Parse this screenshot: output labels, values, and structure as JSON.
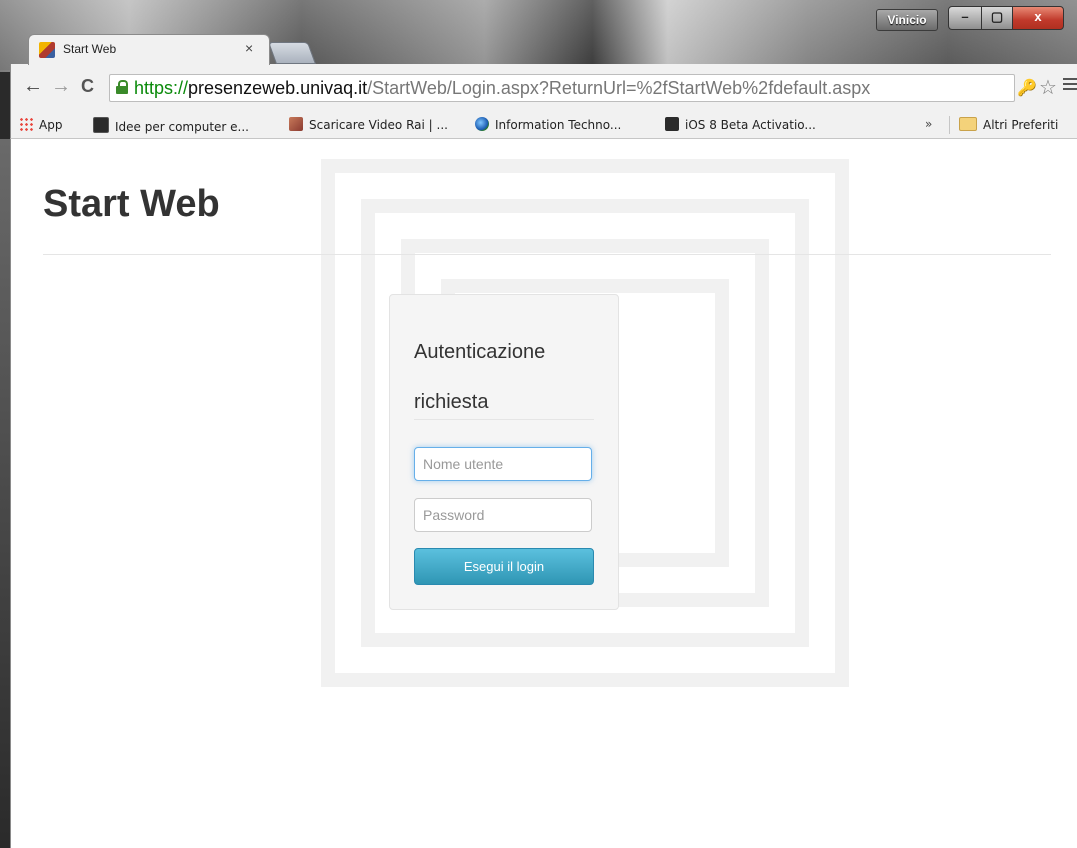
{
  "window": {
    "user_badge": "Vinicio",
    "controls": {
      "minimize": "–",
      "maximize": "▢",
      "close": "x"
    }
  },
  "tabs": [
    {
      "title": "Start Web",
      "close_glyph": "×",
      "favicon": "start-web-favicon"
    }
  ],
  "toolbar": {
    "back_glyph": "←",
    "forward_glyph": "→",
    "reload_glyph": "C",
    "url": {
      "scheme": "https://",
      "host": "presenzeweb.univaq.it",
      "path": "/StartWeb/Login.aspx?ReturnUrl=%2fStartWeb%2fdefault.aspx"
    },
    "key_glyph": "🔑",
    "star_glyph": "☆"
  },
  "bookmarks": {
    "items": [
      {
        "label": "App",
        "icon": "apps-icon"
      },
      {
        "label": "Idee per computer e...",
        "icon": "ideas-icon"
      },
      {
        "label": "Scaricare Video Rai | ...",
        "icon": "rai-icon"
      },
      {
        "label": "Information Techno...",
        "icon": "globe-icon"
      },
      {
        "label": "iOS 8 Beta Activatio...",
        "icon": "ios-icon"
      }
    ],
    "overflow_glyph": "»",
    "other": {
      "label": "Altri Preferiti",
      "icon": "folder-icon"
    }
  },
  "page": {
    "site_title": "Start Web",
    "login": {
      "heading": "Autenticazione richiesta",
      "username_placeholder": "Nome utente",
      "password_placeholder": "Password",
      "submit_label": "Esegui il login",
      "accent_color": "#2f96b4"
    }
  }
}
